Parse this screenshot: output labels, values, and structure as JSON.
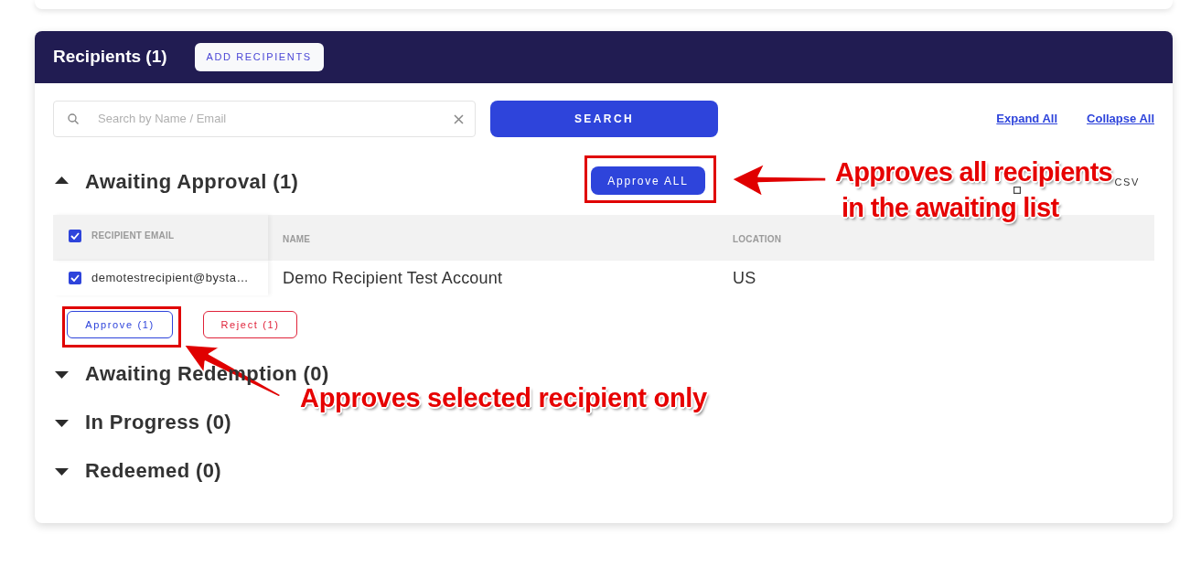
{
  "header": {
    "title": "Recipients (1)",
    "add_button": "ADD RECIPIENTS"
  },
  "search": {
    "placeholder": "Search by Name / Email",
    "button": "SEARCH"
  },
  "links": [
    "Expand All",
    "Collapse All"
  ],
  "sections": [
    {
      "title": "Awaiting Approval (1)",
      "expanded": true,
      "approve_all": {
        "label": "Approve ALL",
        "highlighted": true
      },
      "download": {
        "label": "CSV"
      },
      "table": {
        "all_checked": true,
        "columns": [
          "RECIPIENT EMAIL",
          "NAME",
          "LOCATION"
        ],
        "rows": [
          {
            "checked": true,
            "cells": [
              "demotestrecipient@bysta…",
              "Demo Recipient Test Account",
              "US"
            ]
          }
        ]
      },
      "actions": [
        {
          "kind": "approve",
          "label": "Approve (1)",
          "highlighted": true
        },
        {
          "kind": "reject",
          "label": "Reject (1)",
          "highlighted": false
        }
      ]
    },
    {
      "title": "Awaiting Redemption (0)",
      "expanded": false
    },
    {
      "title": "In Progress (0)",
      "expanded": false
    },
    {
      "title": "Redeemed (0)",
      "expanded": false
    }
  ],
  "annotations": [
    {
      "lines": [
        "Approves all recipients",
        "in the awaiting list"
      ]
    },
    {
      "lines": [
        "Approves selected recipient only"
      ]
    }
  ]
}
